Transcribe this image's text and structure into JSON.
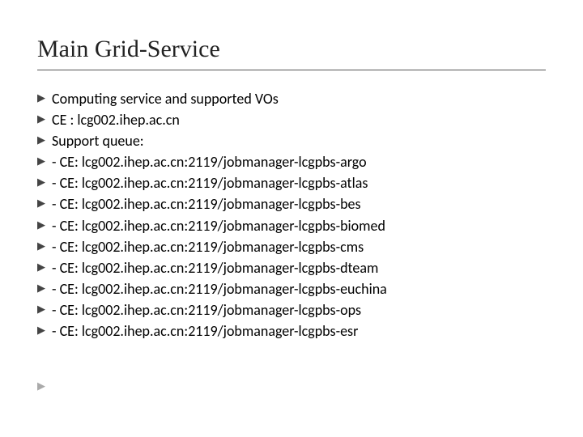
{
  "title": "Main Grid-Service",
  "items": [
    "Computing service  and supported VOs",
    " CE : lcg002.ihep.ac.cn",
    "Support queue:",
    "- CE: lcg002.ihep.ac.cn:2119/jobmanager-lcgpbs-argo",
    "- CE: lcg002.ihep.ac.cn:2119/jobmanager-lcgpbs-atlas",
    "- CE: lcg002.ihep.ac.cn:2119/jobmanager-lcgpbs-bes",
    "- CE: lcg002.ihep.ac.cn:2119/jobmanager-lcgpbs-biomed",
    "- CE: lcg002.ihep.ac.cn:2119/jobmanager-lcgpbs-cms",
    "- CE: lcg002.ihep.ac.cn:2119/jobmanager-lcgpbs-dteam",
    "- CE: lcg002.ihep.ac.cn:2119/jobmanager-lcgpbs-euchina",
    "- CE: lcg002.ihep.ac.cn:2119/jobmanager-lcgpbs-ops",
    "- CE: lcg002.ihep.ac.cn:2119/jobmanager-lcgpbs-esr"
  ],
  "bullet_glyph": "▶"
}
